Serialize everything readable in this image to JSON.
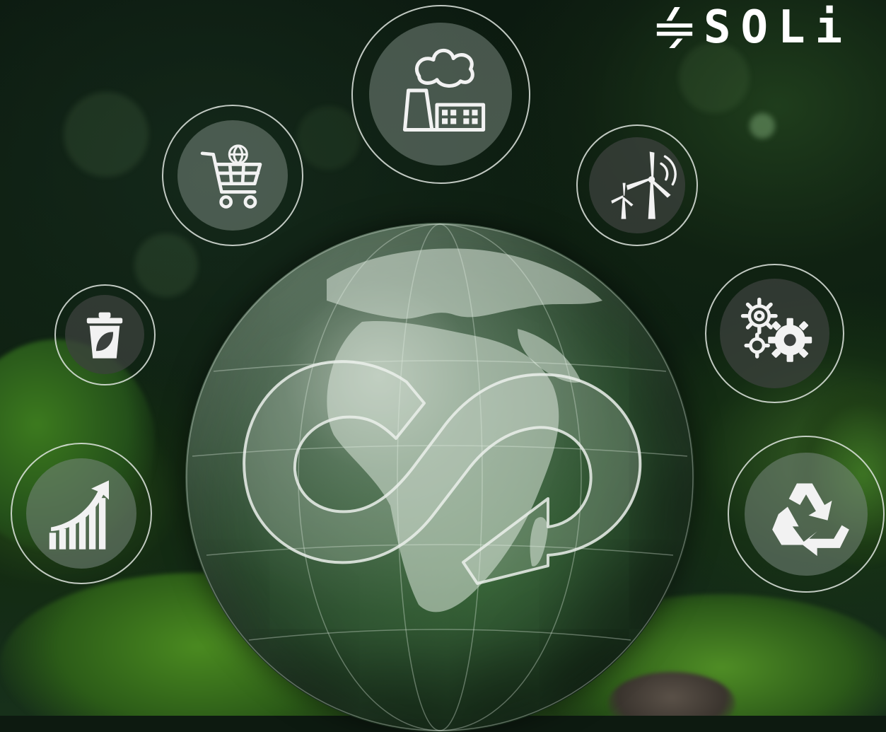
{
  "brand": {
    "name": "SOLi"
  },
  "colors": {
    "background": "#0d1a10",
    "moss": "#3f7a1c",
    "icon_ring": "#e1e6e1",
    "icon_glyph": "#f2f2f2"
  },
  "icons": [
    "factory-icon",
    "shopping-cart-icon",
    "wind-turbine-icon",
    "recycle-bin-icon",
    "gears-icon",
    "growth-chart-icon",
    "recycling-icon",
    "circular-economy-loop-icon"
  ]
}
